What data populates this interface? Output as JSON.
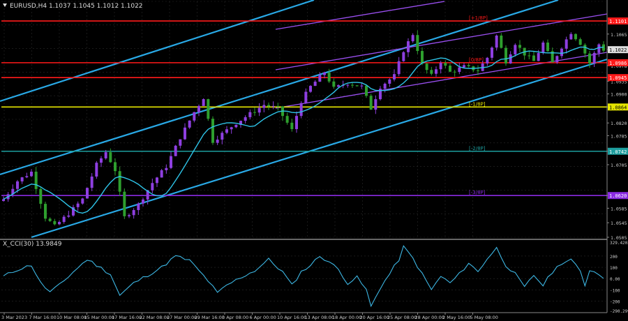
{
  "window": {
    "title": "EURUSD,H4  1.1037 1.1045 1.1012 1.1022",
    "indicator_title": "X_CCI(30) 13.9849"
  },
  "colors": {
    "background": "#000000",
    "grid": "#2a2a2a",
    "bull_candle": "#8e3fe0",
    "bear_candle": "#2e9f2e",
    "moving_average": "#2ec4e8",
    "channel_outer": "#29a9e6",
    "channel_inner": "#9a4ff0",
    "red_level": "#ff1a1a",
    "yellow_level": "#e6e600",
    "teal_level": "#1d9e9e",
    "purple_level": "#8a2be2",
    "cci_line": "#3db7e4"
  },
  "chart_data": [
    {
      "type": "candlestick",
      "symbol": "EURUSD",
      "timeframe": "H4",
      "title": "EURUSD,H4  1.1037 1.1045 1.1012 1.1022",
      "ylim": [
        1.0505,
        1.1155
      ],
      "y_ticks": [
        "1.1065",
        "1.1022",
        "1.0978",
        "1.0935",
        "1.0900",
        "1.0864",
        "1.0820",
        "1.0785",
        "1.0742",
        "1.0705",
        "1.0620",
        "1.0585",
        "1.0545",
        "1.0505"
      ],
      "x_ticks": [
        "3 Mar 2023",
        "7 Mar 16:00",
        "10 Mar 08:00",
        "15 Mar 00:00",
        "17 Mar 16:00",
        "22 Mar 08:00",
        "27 Mar 00:00",
        "29 Mar 16:00",
        "3 Apr 08:00",
        "6 Apr 00:00",
        "10 Apr 16:00",
        "13 Apr 08:00",
        "18 Apr 00:00",
        "20 Apr 16:00",
        "25 Apr 08:00",
        "28 Apr 00:00",
        "2 May 16:00",
        "5 May 08:00"
      ],
      "close_anchors": [
        [
          0,
          1.061
        ],
        [
          3,
          1.066
        ],
        [
          6,
          1.0685
        ],
        [
          9,
          1.056
        ],
        [
          11,
          1.0535
        ],
        [
          14,
          1.057
        ],
        [
          17,
          1.061
        ],
        [
          20,
          1.0705
        ],
        [
          22,
          1.074
        ],
        [
          24,
          1.069
        ],
        [
          26,
          1.056
        ],
        [
          29,
          1.0595
        ],
        [
          32,
          1.0655
        ],
        [
          35,
          1.07
        ],
        [
          38,
          1.078
        ],
        [
          41,
          1.085
        ],
        [
          43,
          1.089
        ],
        [
          45,
          1.077
        ],
        [
          47,
          1.079
        ],
        [
          50,
          1.082
        ],
        [
          53,
          1.0845
        ],
        [
          56,
          1.087
        ],
        [
          59,
          1.086
        ],
        [
          62,
          1.08
        ],
        [
          64,
          1.088
        ],
        [
          66,
          1.092
        ],
        [
          69,
          1.096
        ],
        [
          71,
          1.0915
        ],
        [
          74,
          1.093
        ],
        [
          77,
          1.092
        ],
        [
          79,
          1.086
        ],
        [
          81,
          1.092
        ],
        [
          84,
          1.095
        ],
        [
          86,
          1.102
        ],
        [
          88,
          1.1065
        ],
        [
          90,
          1.098
        ],
        [
          92,
          1.095
        ],
        [
          94,
          1.099
        ],
        [
          96,
          1.096
        ],
        [
          99,
          1.0975
        ],
        [
          102,
          1.0965
        ],
        [
          104,
          1.1
        ],
        [
          106,
          1.106
        ],
        [
          108,
          1.099
        ],
        [
          110,
          1.104
        ],
        [
          112,
          1.101
        ],
        [
          114,
          1.099
        ],
        [
          116,
          1.104
        ],
        [
          118,
          1.0985
        ],
        [
          120,
          1.103
        ],
        [
          122,
          1.107
        ],
        [
          124,
          1.104
        ],
        [
          126,
          1.0985
        ],
        [
          128,
          1.1037
        ],
        [
          129,
          1.1022
        ]
      ],
      "last_price": "1.1022",
      "levels": [
        {
          "price": 1.1101,
          "label": "1.1101",
          "marker": "[+1/8P]",
          "color": "#ff1a1a"
        },
        {
          "price": 1.0986,
          "label": "1.0986",
          "marker": "[0/8P]",
          "color": "#ff1a1a"
        },
        {
          "price": 1.0945,
          "label": "1.0945",
          "marker": "",
          "color": "#ff1a1a"
        },
        {
          "price": 1.0864,
          "label": "1.0864",
          "marker": "[-1/8P]",
          "color": "#e6e600"
        },
        {
          "price": 1.0742,
          "label": "1.0742",
          "marker": "[-2/8P]",
          "color": "#1d9e9e"
        },
        {
          "price": 1.062,
          "label": "1.0620",
          "marker": "[-3/8P]",
          "color": "#8a2be2"
        }
      ],
      "grid": true
    },
    {
      "type": "line",
      "title": "X_CCI(30) 13.9849",
      "ylim": [
        -290,
        330
      ],
      "y_ticks": [
        "329.4203",
        "200",
        "100",
        "0.00",
        "-100",
        "-200",
        "-290.2999"
      ],
      "last_value": 13.9849,
      "anchors": [
        [
          0,
          20
        ],
        [
          3,
          80
        ],
        [
          6,
          120
        ],
        [
          8,
          -40
        ],
        [
          10,
          -120
        ],
        [
          12,
          -60
        ],
        [
          15,
          60
        ],
        [
          18,
          170
        ],
        [
          20,
          120
        ],
        [
          23,
          40
        ],
        [
          25,
          -150
        ],
        [
          28,
          -40
        ],
        [
          31,
          30
        ],
        [
          34,
          100
        ],
        [
          37,
          200
        ],
        [
          40,
          160
        ],
        [
          42,
          70
        ],
        [
          44,
          -20
        ],
        [
          46,
          -130
        ],
        [
          48,
          -60
        ],
        [
          51,
          10
        ],
        [
          54,
          70
        ],
        [
          57,
          170
        ],
        [
          60,
          60
        ],
        [
          62,
          -60
        ],
        [
          64,
          60
        ],
        [
          66,
          120
        ],
        [
          68,
          200
        ],
        [
          70,
          150
        ],
        [
          72,
          80
        ],
        [
          74,
          -40
        ],
        [
          76,
          10
        ],
        [
          78,
          -100
        ],
        [
          79,
          -250
        ],
        [
          81,
          -80
        ],
        [
          83,
          40
        ],
        [
          85,
          170
        ],
        [
          86,
          280
        ],
        [
          88,
          180
        ],
        [
          90,
          40
        ],
        [
          92,
          -100
        ],
        [
          94,
          20
        ],
        [
          96,
          -40
        ],
        [
          98,
          40
        ],
        [
          100,
          140
        ],
        [
          102,
          60
        ],
        [
          104,
          180
        ],
        [
          106,
          270
        ],
        [
          108,
          120
        ],
        [
          110,
          40
        ],
        [
          112,
          -80
        ],
        [
          114,
          30
        ],
        [
          116,
          -60
        ],
        [
          118,
          60
        ],
        [
          120,
          140
        ],
        [
          122,
          170
        ],
        [
          124,
          60
        ],
        [
          125,
          -60
        ],
        [
          126,
          80
        ],
        [
          128,
          40
        ],
        [
          129,
          14
        ]
      ],
      "grid": true
    }
  ]
}
